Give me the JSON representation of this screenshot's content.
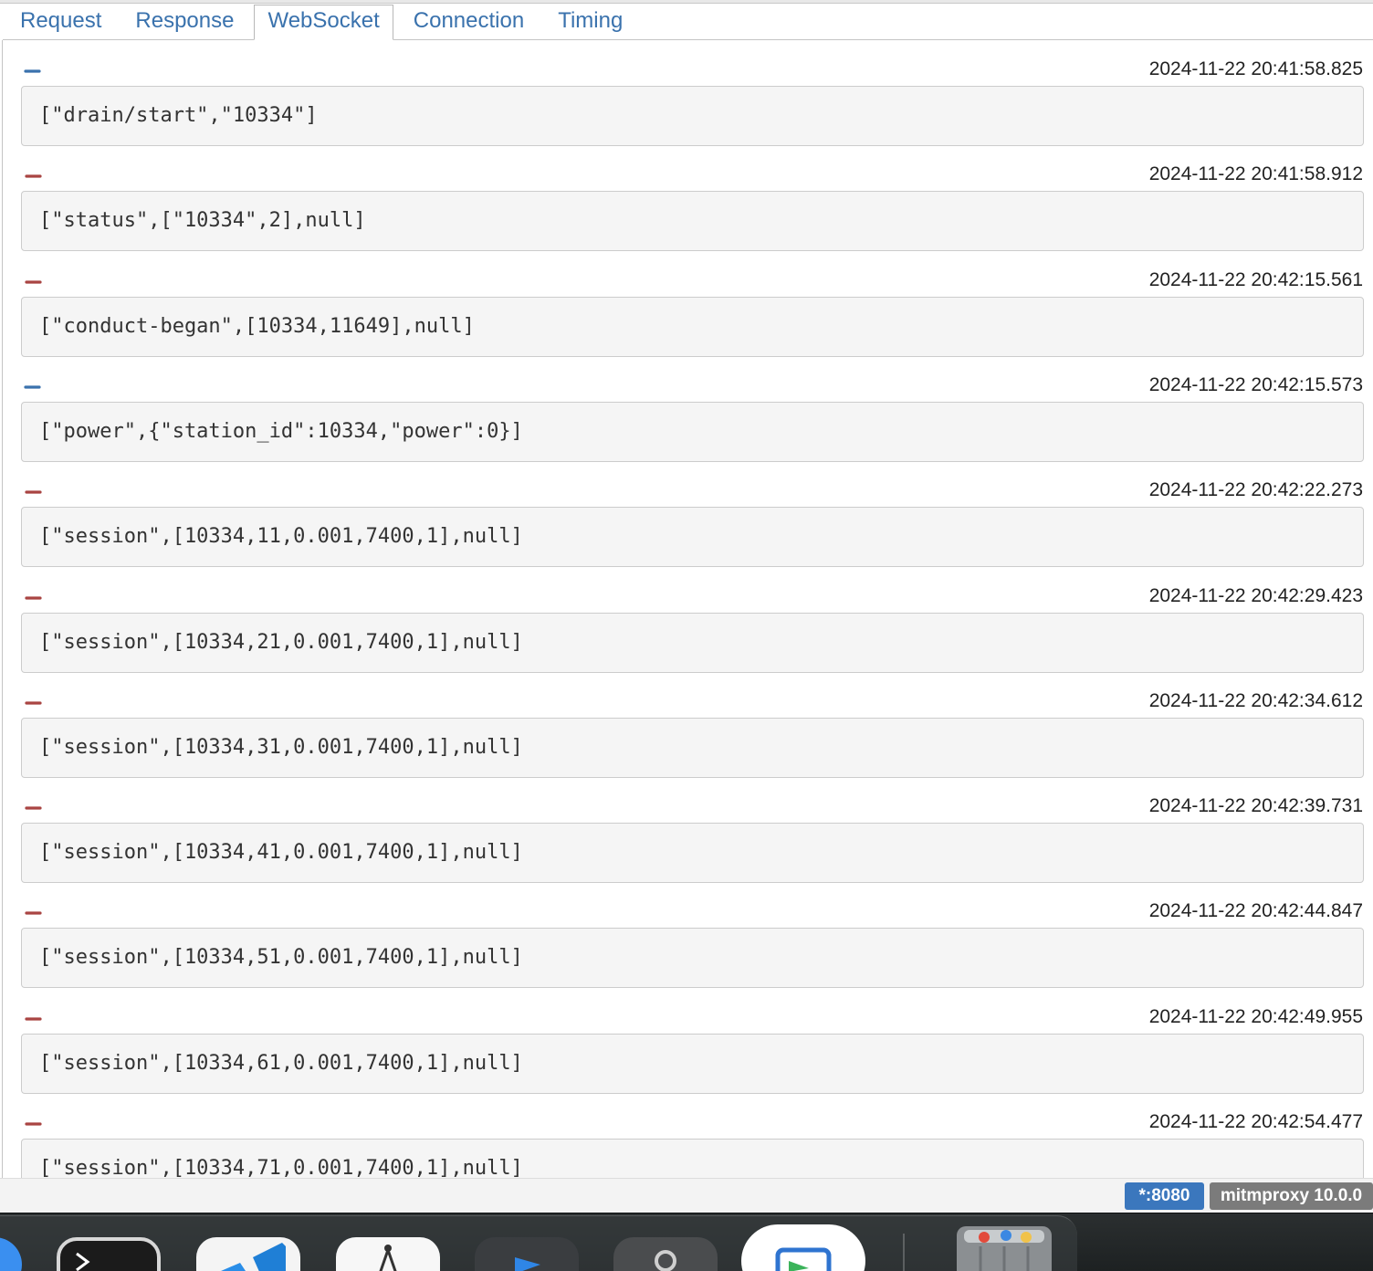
{
  "tabs": [
    {
      "label": "Request"
    },
    {
      "label": "Response"
    },
    {
      "label": "WebSocket",
      "active": true
    },
    {
      "label": "Connection"
    },
    {
      "label": "Timing"
    }
  ],
  "messages": [
    {
      "direction": "outgoing",
      "timestamp": "2024-11-22 20:41:58.825",
      "content": "[\"drain/start\",\"10334\"]"
    },
    {
      "direction": "incoming",
      "timestamp": "2024-11-22 20:41:58.912",
      "content": "[\"status\",[\"10334\",2],null]"
    },
    {
      "direction": "incoming",
      "timestamp": "2024-11-22 20:42:15.561",
      "content": "[\"conduct-began\",[10334,11649],null]"
    },
    {
      "direction": "outgoing",
      "timestamp": "2024-11-22 20:42:15.573",
      "content": "[\"power\",{\"station_id\":10334,\"power\":0}]"
    },
    {
      "direction": "incoming",
      "timestamp": "2024-11-22 20:42:22.273",
      "content": "[\"session\",[10334,11,0.001,7400,1],null]"
    },
    {
      "direction": "incoming",
      "timestamp": "2024-11-22 20:42:29.423",
      "content": "[\"session\",[10334,21,0.001,7400,1],null]"
    },
    {
      "direction": "incoming",
      "timestamp": "2024-11-22 20:42:34.612",
      "content": "[\"session\",[10334,31,0.001,7400,1],null]"
    },
    {
      "direction": "incoming",
      "timestamp": "2024-11-22 20:42:39.731",
      "content": "[\"session\",[10334,41,0.001,7400,1],null]"
    },
    {
      "direction": "incoming",
      "timestamp": "2024-11-22 20:42:44.847",
      "content": "[\"session\",[10334,51,0.001,7400,1],null]"
    },
    {
      "direction": "incoming",
      "timestamp": "2024-11-22 20:42:49.955",
      "content": "[\"session\",[10334,61,0.001,7400,1],null]"
    },
    {
      "direction": "incoming",
      "timestamp": "2024-11-22 20:42:54.477",
      "content": "[\"session\",[10334,71,0.001,7400,1],null]"
    }
  ],
  "colors": {
    "outgoing_arrow": "#3a72ad",
    "incoming_arrow": "#a94442",
    "port_badge": "#3b77bd",
    "version_badge": "#7b7b7b"
  },
  "icons": {
    "outgoing": "arrow-right-icon",
    "incoming": "arrow-left-icon"
  },
  "status": {
    "port": "*:8080",
    "version": "mitmproxy 10.0.0"
  }
}
